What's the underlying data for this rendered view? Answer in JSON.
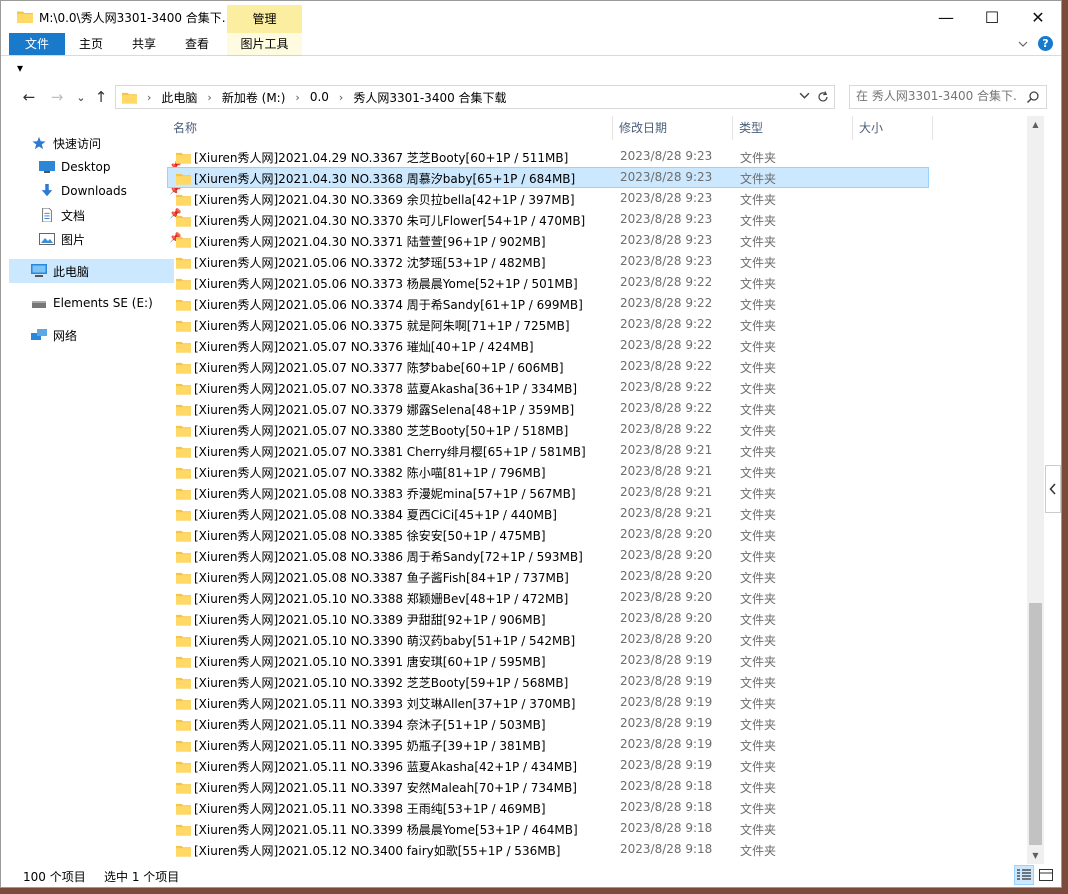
{
  "window": {
    "title": "M:\\0.0\\秀人网3301-3400 合集下...",
    "contextual_tab": "管理",
    "contextual_group": "图片工具",
    "controls": {
      "minimize": "—",
      "maximize": "☐",
      "close": "✕"
    }
  },
  "ribbon": {
    "tabs": [
      {
        "label": "文件"
      },
      {
        "label": "主页"
      },
      {
        "label": "共享"
      },
      {
        "label": "查看"
      }
    ],
    "help_label": "?"
  },
  "qat": {
    "dropdown": "▾"
  },
  "nav": {
    "back": "←",
    "forward": "→",
    "recent": "⌄",
    "up": "↑",
    "breadcrumb": [
      "此电脑",
      "新加卷 (M:)",
      "0.0",
      "秀人网3301-3400 合集下载"
    ],
    "search_placeholder": "在 秀人网3301-3400 合集下..."
  },
  "sidebar": {
    "items": [
      {
        "label": "快速访问",
        "icon": "star-icon"
      },
      {
        "label": "Desktop",
        "icon": "desktop-icon"
      },
      {
        "label": "Downloads",
        "icon": "download-icon"
      },
      {
        "label": "文档",
        "icon": "document-icon"
      },
      {
        "label": "图片",
        "icon": "picture-icon"
      },
      {
        "label": "此电脑",
        "icon": "computer-icon"
      },
      {
        "label": "Elements SE (E:)",
        "icon": "drive-icon"
      },
      {
        "label": "网络",
        "icon": "network-icon"
      }
    ]
  },
  "columns": {
    "name": "名称",
    "date": "修改日期",
    "type": "类型",
    "size": "大小"
  },
  "colors": {
    "selection": "#cce8ff",
    "selection_border": "#99d1ff",
    "accent": "#1979ca",
    "folder": "#f4c54b"
  },
  "files": [
    {
      "name": "[Xiuren秀人网]2021.04.29 NO.3367 芝芝Booty[60+1P / 511MB]",
      "date": "2023/8/28 9:23",
      "type": "文件夹"
    },
    {
      "name": "[Xiuren秀人网]2021.04.30 NO.3368 周慕汐baby[65+1P / 684MB]",
      "date": "2023/8/28 9:23",
      "type": "文件夹",
      "selected": true
    },
    {
      "name": "[Xiuren秀人网]2021.04.30 NO.3369 余贝拉bella[42+1P / 397MB]",
      "date": "2023/8/28 9:23",
      "type": "文件夹"
    },
    {
      "name": "[Xiuren秀人网]2021.04.30 NO.3370 朱可儿Flower[54+1P / 470MB]",
      "date": "2023/8/28 9:23",
      "type": "文件夹"
    },
    {
      "name": "[Xiuren秀人网]2021.04.30 NO.3371 陆萱萱[96+1P / 902MB]",
      "date": "2023/8/28 9:23",
      "type": "文件夹"
    },
    {
      "name": "[Xiuren秀人网]2021.05.06 NO.3372 沈梦瑶[53+1P / 482MB]",
      "date": "2023/8/28 9:23",
      "type": "文件夹"
    },
    {
      "name": "[Xiuren秀人网]2021.05.06 NO.3373 杨晨晨Yome[52+1P / 501MB]",
      "date": "2023/8/28 9:22",
      "type": "文件夹"
    },
    {
      "name": "[Xiuren秀人网]2021.05.06 NO.3374 周于希Sandy[61+1P / 699MB]",
      "date": "2023/8/28 9:22",
      "type": "文件夹"
    },
    {
      "name": "[Xiuren秀人网]2021.05.06 NO.3375 就是阿朱啊[71+1P / 725MB]",
      "date": "2023/8/28 9:22",
      "type": "文件夹"
    },
    {
      "name": "[Xiuren秀人网]2021.05.07 NO.3376 璀灿[40+1P / 424MB]",
      "date": "2023/8/28 9:22",
      "type": "文件夹"
    },
    {
      "name": "[Xiuren秀人网]2021.05.07 NO.3377 陈梦babe[60+1P / 606MB]",
      "date": "2023/8/28 9:22",
      "type": "文件夹"
    },
    {
      "name": "[Xiuren秀人网]2021.05.07 NO.3378 蓝夏Akasha[36+1P / 334MB]",
      "date": "2023/8/28 9:22",
      "type": "文件夹"
    },
    {
      "name": "[Xiuren秀人网]2021.05.07 NO.3379 娜露Selena[48+1P / 359MB]",
      "date": "2023/8/28 9:22",
      "type": "文件夹"
    },
    {
      "name": "[Xiuren秀人网]2021.05.07 NO.3380 芝芝Booty[50+1P / 518MB]",
      "date": "2023/8/28 9:22",
      "type": "文件夹"
    },
    {
      "name": "[Xiuren秀人网]2021.05.07 NO.3381 Cherry绯月樱[65+1P / 581MB]",
      "date": "2023/8/28 9:21",
      "type": "文件夹"
    },
    {
      "name": "[Xiuren秀人网]2021.05.07 NO.3382 陈小喵[81+1P / 796MB]",
      "date": "2023/8/28 9:21",
      "type": "文件夹"
    },
    {
      "name": "[Xiuren秀人网]2021.05.08 NO.3383 乔漫妮mina[57+1P / 567MB]",
      "date": "2023/8/28 9:21",
      "type": "文件夹"
    },
    {
      "name": "[Xiuren秀人网]2021.05.08 NO.3384 夏西CiCi[45+1P / 440MB]",
      "date": "2023/8/28 9:21",
      "type": "文件夹"
    },
    {
      "name": "[Xiuren秀人网]2021.05.08 NO.3385 徐安安[50+1P / 475MB]",
      "date": "2023/8/28 9:20",
      "type": "文件夹"
    },
    {
      "name": "[Xiuren秀人网]2021.05.08 NO.3386 周于希Sandy[72+1P / 593MB]",
      "date": "2023/8/28 9:20",
      "type": "文件夹"
    },
    {
      "name": "[Xiuren秀人网]2021.05.08 NO.3387 鱼子酱Fish[84+1P / 737MB]",
      "date": "2023/8/28 9:20",
      "type": "文件夹"
    },
    {
      "name": "[Xiuren秀人网]2021.05.10 NO.3388 郑颖姗Bev[48+1P / 472MB]",
      "date": "2023/8/28 9:20",
      "type": "文件夹"
    },
    {
      "name": "[Xiuren秀人网]2021.05.10 NO.3389 尹甜甜[92+1P / 906MB]",
      "date": "2023/8/28 9:20",
      "type": "文件夹"
    },
    {
      "name": "[Xiuren秀人网]2021.05.10 NO.3390 萌汉药baby[51+1P / 542MB]",
      "date": "2023/8/28 9:20",
      "type": "文件夹"
    },
    {
      "name": "[Xiuren秀人网]2021.05.10 NO.3391 唐安琪[60+1P / 595MB]",
      "date": "2023/8/28 9:19",
      "type": "文件夹"
    },
    {
      "name": "[Xiuren秀人网]2021.05.10 NO.3392 芝芝Booty[59+1P / 568MB]",
      "date": "2023/8/28 9:19",
      "type": "文件夹"
    },
    {
      "name": "[Xiuren秀人网]2021.05.11 NO.3393 刘艾琳Allen[37+1P / 370MB]",
      "date": "2023/8/28 9:19",
      "type": "文件夹"
    },
    {
      "name": "[Xiuren秀人网]2021.05.11 NO.3394 奈沐子[51+1P / 503MB]",
      "date": "2023/8/28 9:19",
      "type": "文件夹"
    },
    {
      "name": "[Xiuren秀人网]2021.05.11 NO.3395 奶瓶子[39+1P / 381MB]",
      "date": "2023/8/28 9:19",
      "type": "文件夹"
    },
    {
      "name": "[Xiuren秀人网]2021.05.11 NO.3396 蓝夏Akasha[42+1P / 434MB]",
      "date": "2023/8/28 9:19",
      "type": "文件夹"
    },
    {
      "name": "[Xiuren秀人网]2021.05.11 NO.3397 安然Maleah[70+1P / 734MB]",
      "date": "2023/8/28 9:18",
      "type": "文件夹"
    },
    {
      "name": "[Xiuren秀人网]2021.05.11 NO.3398 王雨纯[53+1P / 469MB]",
      "date": "2023/8/28 9:18",
      "type": "文件夹"
    },
    {
      "name": "[Xiuren秀人网]2021.05.11 NO.3399 杨晨晨Yome[53+1P / 464MB]",
      "date": "2023/8/28 9:18",
      "type": "文件夹"
    },
    {
      "name": "[Xiuren秀人网]2021.05.12 NO.3400 fairy如歌[55+1P / 536MB]",
      "date": "2023/8/28 9:18",
      "type": "文件夹"
    }
  ],
  "status": {
    "item_count": "100 个项目",
    "selected": "选中 1 个项目"
  }
}
